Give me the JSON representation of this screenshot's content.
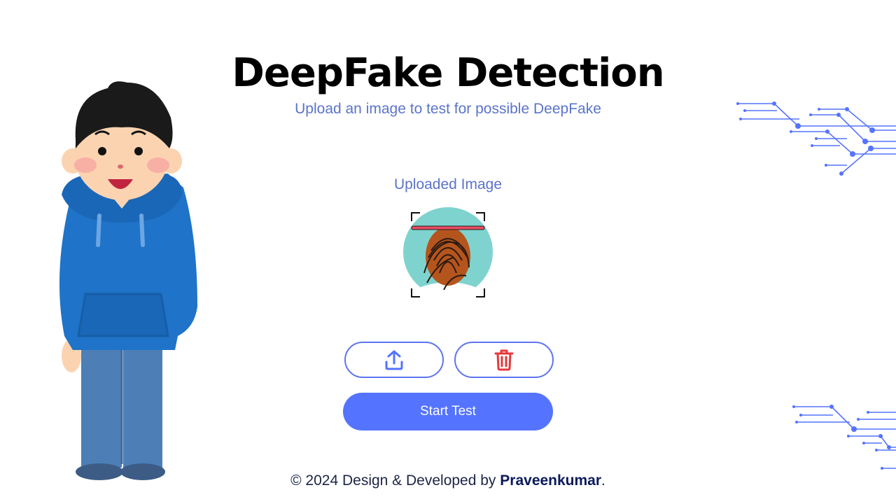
{
  "header": {
    "title": "DeepFake Detection",
    "subtitle": "Upload an image to test for possible DeepFake"
  },
  "preview": {
    "label": "Uploaded Image",
    "icon": "fingerprint-scan-icon"
  },
  "actions": {
    "upload_icon": "upload-icon",
    "delete_icon": "trash-icon",
    "start_label": "Start Test"
  },
  "footer": {
    "prefix": "© 2024 Design & Developed by ",
    "author": "Praveenkumar",
    "suffix": "."
  },
  "colors": {
    "accent": "#5473ff",
    "subtitle": "#5b74c9",
    "danger": "#e5383b"
  }
}
